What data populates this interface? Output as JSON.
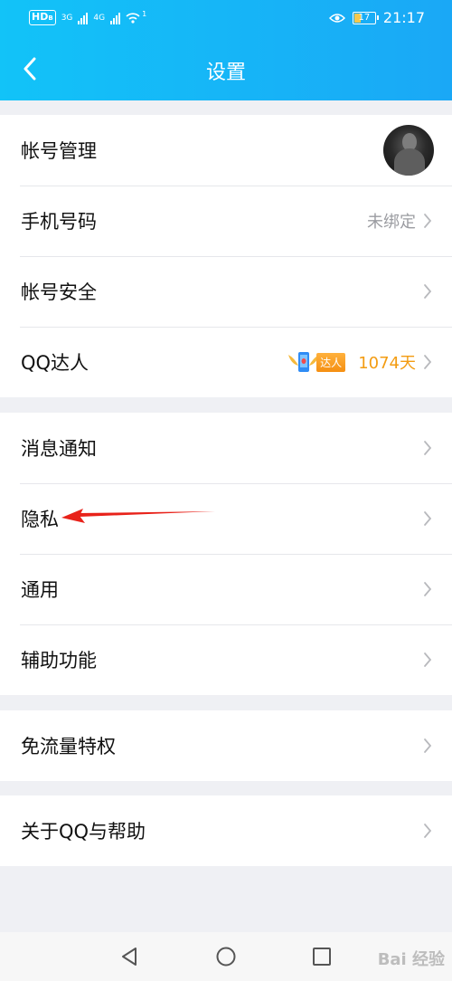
{
  "status_bar": {
    "hd": "HD",
    "hd_sub": "B",
    "network1": "3G",
    "network2": "4G",
    "wifi_sup": "1",
    "battery": "17",
    "time": "21:17"
  },
  "header": {
    "title": "设置"
  },
  "groups": [
    {
      "items": [
        {
          "label": "帐号管理",
          "right": "avatar"
        },
        {
          "label": "手机号码",
          "value": "未绑定"
        },
        {
          "label": "帐号安全"
        },
        {
          "label": "QQ达人",
          "badge": "达人",
          "days": "1074天"
        }
      ]
    },
    {
      "items": [
        {
          "label": "消息通知"
        },
        {
          "label": "隐私"
        },
        {
          "label": "通用"
        },
        {
          "label": "辅助功能"
        }
      ]
    },
    {
      "items": [
        {
          "label": "免流量特权"
        }
      ]
    },
    {
      "items": [
        {
          "label": "关于QQ与帮助"
        }
      ]
    }
  ],
  "watermark": "Bai 经验",
  "colors": {
    "header_gradient_start": "#12c3f8",
    "header_gradient_end": "#1aa8f6",
    "background": "#eff0f4",
    "annotation_arrow": "#e8221a",
    "daren_days": "#f39c12"
  },
  "icons": {
    "back": "chevron-left-icon",
    "row_arrow": "chevron-right-icon",
    "nav_back": "triangle-back-icon",
    "nav_home": "circle-home-icon",
    "nav_recent": "square-recent-icon"
  }
}
